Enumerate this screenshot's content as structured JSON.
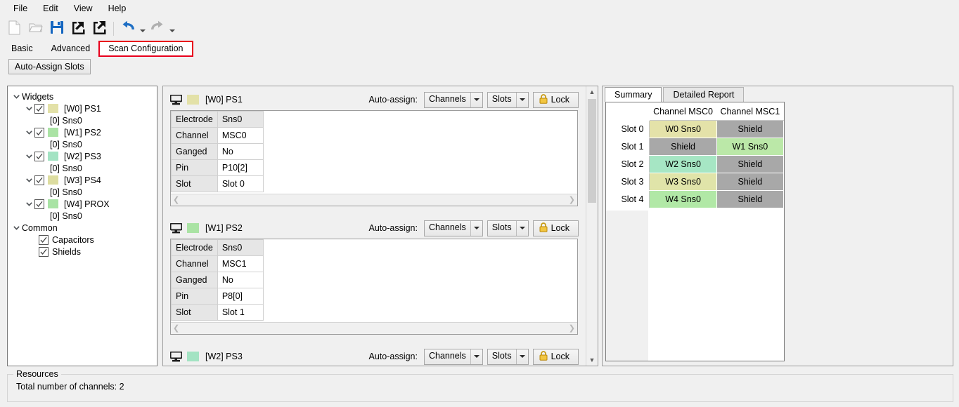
{
  "menu": {
    "items": [
      {
        "label": "File",
        "name": "menu-file"
      },
      {
        "label": "Edit",
        "name": "menu-edit"
      },
      {
        "label": "View",
        "name": "menu-view"
      },
      {
        "label": "Help",
        "name": "menu-help"
      }
    ]
  },
  "toolbar": {
    "buttons": [
      {
        "icon": "new-file-icon",
        "name": "new-button"
      },
      {
        "icon": "open-folder-icon",
        "name": "open-button"
      },
      {
        "icon": "save-disk-icon",
        "name": "save-button"
      },
      {
        "icon": "import-arrow-icon",
        "name": "import-button"
      },
      {
        "icon": "export-arrow-icon",
        "name": "export-button"
      },
      {
        "icon": "undo-arrow-icon",
        "name": "undo-button"
      },
      {
        "icon": "redo-arrow-icon",
        "name": "redo-button"
      }
    ]
  },
  "tabs": {
    "items": [
      {
        "label": "Basic",
        "active": false,
        "highlight": false
      },
      {
        "label": "Advanced",
        "active": false,
        "highlight": false
      },
      {
        "label": "Scan Configuration",
        "active": true,
        "highlight": true
      }
    ],
    "highlight_color": "#e8001c"
  },
  "command_bar": {
    "auto_assign_slots": "Auto-Assign Slots"
  },
  "tree": {
    "root_label": "Widgets",
    "common_label": "Common",
    "widgets": [
      {
        "label": "[W0] PS1",
        "child": "[0] Sns0",
        "color": "#e3e1a8",
        "checked": true
      },
      {
        "label": "[W1] PS2",
        "child": "[0] Sns0",
        "color": "#aae3a4",
        "checked": true
      },
      {
        "label": "[W2] PS3",
        "child": "[0] Sns0",
        "color": "#a3e3c3",
        "checked": true
      },
      {
        "label": "[W3] PS4",
        "child": "[0] Sns0",
        "color": "#ddddA0",
        "checked": true
      },
      {
        "label": "[W4] PROX",
        "child": "[0] Sns0",
        "color": "#a8e3a4",
        "checked": true
      }
    ],
    "common": [
      {
        "label": "Capacitors",
        "checked": true
      },
      {
        "label": "Shields",
        "checked": true
      }
    ]
  },
  "cards": [
    {
      "title": "[W0] PS1",
      "color": "#e3e1a8",
      "auto_assign_label": "Auto-assign:",
      "channels_label": "Channels",
      "slots_label": "Slots",
      "lock_label": "Lock",
      "rows": [
        {
          "label": "Electrode",
          "value": "Sns0"
        },
        {
          "label": "Channel",
          "value": "MSC0"
        },
        {
          "label": "Ganged",
          "value": "No"
        },
        {
          "label": "Pin",
          "value": "P10[2]"
        },
        {
          "label": "Slot",
          "value": "Slot 0"
        }
      ]
    },
    {
      "title": "[W1] PS2",
      "color": "#aae3a4",
      "auto_assign_label": "Auto-assign:",
      "channels_label": "Channels",
      "slots_label": "Slots",
      "lock_label": "Lock",
      "rows": [
        {
          "label": "Electrode",
          "value": "Sns0"
        },
        {
          "label": "Channel",
          "value": "MSC1"
        },
        {
          "label": "Ganged",
          "value": "No"
        },
        {
          "label": "Pin",
          "value": "P8[0]"
        },
        {
          "label": "Slot",
          "value": "Slot 1"
        }
      ]
    }
  ],
  "card_partial": {
    "title": "[W2] PS3",
    "color": "#a3e3c3",
    "auto_assign_label": "Auto-assign:",
    "channels_label": "Channels",
    "slots_label": "Slots",
    "lock_label": "Lock"
  },
  "right_panel": {
    "tabs": [
      {
        "label": "Summary",
        "active": true
      },
      {
        "label": "Detailed Report",
        "active": false
      }
    ],
    "summary": {
      "columns": [
        "Channel MSC0",
        "Channel MSC1"
      ],
      "rows": [
        {
          "header": "Slot 0",
          "cells": [
            {
              "text": "W0 Sns0",
              "color": "#e4e2a9"
            },
            {
              "text": "Shield",
              "color": "#a8a8a8"
            }
          ]
        },
        {
          "header": "Slot 1",
          "cells": [
            {
              "text": "Shield",
              "color": "#a8a8a8"
            },
            {
              "text": "W1 Sns0",
              "color": "#bbe8a8"
            }
          ]
        },
        {
          "header": "Slot 2",
          "cells": [
            {
              "text": "W2 Sns0",
              "color": "#a6e6c4"
            },
            {
              "text": "Shield",
              "color": "#a8a8a8"
            }
          ]
        },
        {
          "header": "Slot 3",
          "cells": [
            {
              "text": "W3 Sns0",
              "color": "#e0e4a9"
            },
            {
              "text": "Shield",
              "color": "#a8a8a8"
            }
          ]
        },
        {
          "header": "Slot 4",
          "cells": [
            {
              "text": "W4 Sns0",
              "color": "#b1e8a6"
            },
            {
              "text": "Shield",
              "color": "#a8a8a8"
            }
          ]
        }
      ]
    }
  },
  "resources": {
    "legend": "Resources",
    "text": "Total number of channels: 2"
  }
}
